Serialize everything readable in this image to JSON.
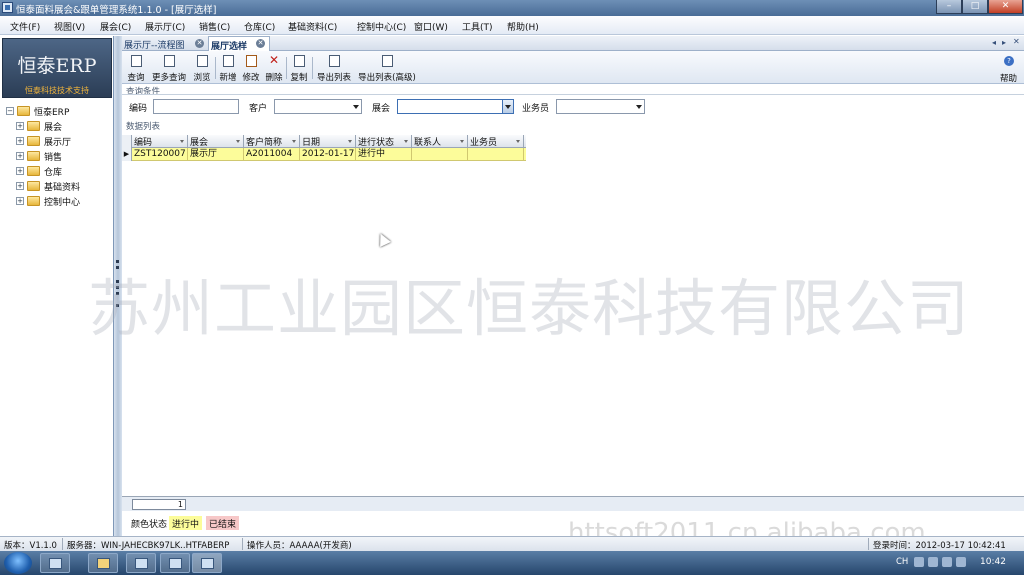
{
  "window": {
    "title": "恒泰面料展会&跟单管理系统1.1.0 - [展厅选样]",
    "min": "–",
    "max": "□",
    "close": "✕"
  },
  "menu": [
    "文件(F)",
    "视图(V)",
    "展会(C)",
    "展示厅(C)",
    "销售(C)",
    "仓库(C)",
    "基础资料(C)",
    "控制中心(C)",
    "窗口(W)",
    "工具(T)",
    "帮助(H)"
  ],
  "logo": {
    "title": "恒泰ERP",
    "subtitle": "恒泰科技技术支持"
  },
  "tree": {
    "root": "恒泰ERP",
    "items": [
      "展会",
      "展示厅",
      "销售",
      "仓库",
      "基础资料",
      "控制中心"
    ]
  },
  "tabs": [
    {
      "label": "展示厅--流程图",
      "active": false
    },
    {
      "label": "展厅选样",
      "active": true
    }
  ],
  "toolbar": {
    "buttons": [
      "查询",
      "更多查询",
      "浏览",
      "新增",
      "修改",
      "删除",
      "复制",
      "导出列表",
      "导出列表(高级)"
    ],
    "help": "帮助"
  },
  "query": {
    "section_title": "查询条件",
    "fields": {
      "code": {
        "label": "编码",
        "value": ""
      },
      "customer": {
        "label": "客户",
        "value": ""
      },
      "fair": {
        "label": "展会",
        "value": ""
      },
      "salesman": {
        "label": "业务员",
        "value": ""
      }
    }
  },
  "grid": {
    "section_title": "数据列表",
    "columns": [
      "编码",
      "展会",
      "客户简称",
      "日期",
      "进行状态",
      "联系人",
      "业务员"
    ],
    "rows": [
      [
        "ZST120007",
        "展示厅",
        "A2011004",
        "2012-01-17",
        "进行中",
        "",
        ""
      ]
    ]
  },
  "pager": {
    "page": "1"
  },
  "legend": {
    "label": "颜色状态",
    "in_progress": "进行中",
    "finished": "已结束"
  },
  "watermark": "苏州工业园区恒泰科技有限公司",
  "watermark2": "httsoft2011.cn.alibaba.com",
  "statusbar": {
    "version": "版本：V1.1.0",
    "server": "服务器：WIN-JAHECBK97LK..HTFABERP",
    "operator": "操作人员：AAAAA(开发商)",
    "login_time": "登录时间：2012-03-17 10:42:41"
  },
  "taskbar": {
    "lang": "CH",
    "clock": "10:42"
  },
  "colors": {
    "row_in_progress": "#fcfc9a",
    "finished": "#f7c8c8",
    "accent": "#3d6fb3"
  }
}
